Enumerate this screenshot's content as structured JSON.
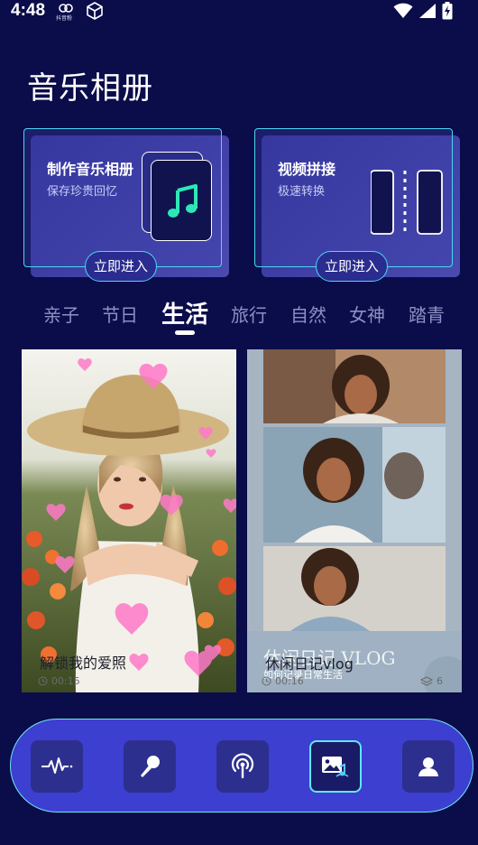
{
  "status_bar": {
    "time": "4:48",
    "app_label": "抖音粉",
    "icons": [
      "app-notification-icon",
      "box-icon",
      "wifi-icon",
      "cellular-signal-icon",
      "battery-charging-icon"
    ]
  },
  "page_title": "音乐相册",
  "feature_cards": [
    {
      "title": "制作音乐相册",
      "subtitle": "保存珍贵回忆",
      "button": "立即进入",
      "icon": "music-note-icon"
    },
    {
      "title": "视频拼接",
      "subtitle": "极速转换",
      "button": "立即进入",
      "icon": "video-splice-icon"
    }
  ],
  "categories": [
    "亲子",
    "节日",
    "生活",
    "旅行",
    "自然",
    "女神",
    "踏青"
  ],
  "active_category": "生活",
  "templates": [
    {
      "caption": "解锁我的爱照",
      "duration": "00:15",
      "image": "woman-with-hat-among-flowers-and-pink-hearts"
    },
    {
      "overlay_title": "休闲日记 VLOG",
      "caption": "休闲日记vlog",
      "overlay_subtitle": "如何记录日常生活",
      "duration": "00:16",
      "layer_count": "6",
      "image": "three-photo-collage-of-smiling-woman"
    }
  ],
  "bottom_nav": [
    {
      "name": "waveform",
      "icon": "waveform-icon",
      "active": false
    },
    {
      "name": "microphone",
      "icon": "microphone-icon",
      "active": false
    },
    {
      "name": "podcast",
      "icon": "podcast-icon",
      "active": false
    },
    {
      "name": "photo-music",
      "icon": "photo-music-icon",
      "active": true
    },
    {
      "name": "profile",
      "icon": "user-icon",
      "active": false
    }
  ],
  "colors": {
    "background": "#0b0c4a",
    "accent": "#49d8f0",
    "card": "#3c3fd0",
    "music_note": "#2ee6b6"
  }
}
